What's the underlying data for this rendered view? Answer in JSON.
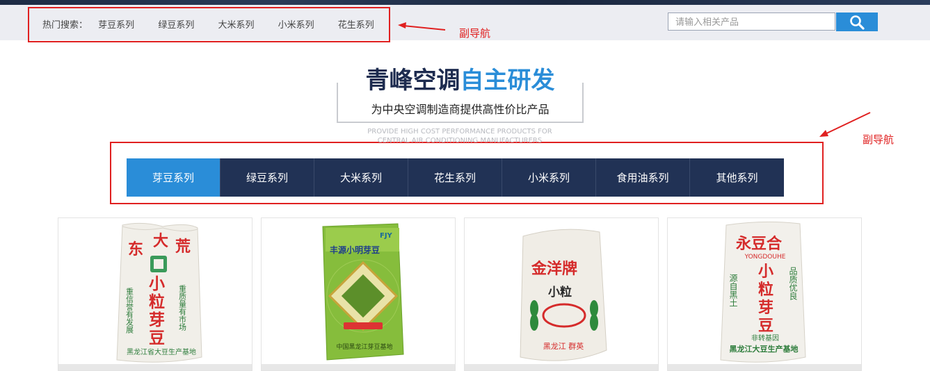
{
  "subnav": {
    "hot_label": "热门搜索：",
    "hot_items": [
      "芽豆系列",
      "绿豆系列",
      "大米系列",
      "小米系列",
      "花生系列"
    ]
  },
  "search": {
    "placeholder": "请输入相关产品",
    "button_icon": "search-icon"
  },
  "annotations": {
    "label_top": "副导航",
    "label_middle": "副导航",
    "color": "#e02020"
  },
  "section_title": {
    "part1": "青峰空调",
    "part2": "自主研发",
    "subtitle": "为中央空调制造商提供高性价比产品",
    "english": "PROVIDE HIGH COST PERFORMANCE PRODUCTS FOR CENTRAL AIR CONDITIONING MANUFACTURERS"
  },
  "tabs": {
    "items": [
      "芽豆系列",
      "绿豆系列",
      "大米系列",
      "花生系列",
      "小米系列",
      "食用油系列",
      "其他系列"
    ],
    "active_index": 0
  },
  "products": [
    {
      "brand": "东大荒",
      "product": "小粒芽豆",
      "side_left": "重信誉有发展",
      "side_right": "重质量有市场",
      "bottom": "黑龙江省大豆生产基地"
    },
    {
      "brand": "丰源小明芽豆",
      "logo": "FJY",
      "bottom": "中国黑龙江芽豆基地"
    },
    {
      "brand": "金洋牌",
      "product": "小粒",
      "bottom": "黑龙江 群英"
    },
    {
      "brand": "永豆合",
      "brand_en": "YONGDOUHE",
      "product": "小粒芽豆",
      "side_left": "源自黑土",
      "side_right": "品质优良",
      "tag": "非转基因",
      "bottom": "黑龙江大豆生产基地"
    }
  ],
  "colors": {
    "navy": "#213255",
    "accent": "#2a8dd8",
    "subnav_bg": "#ecedf2"
  }
}
